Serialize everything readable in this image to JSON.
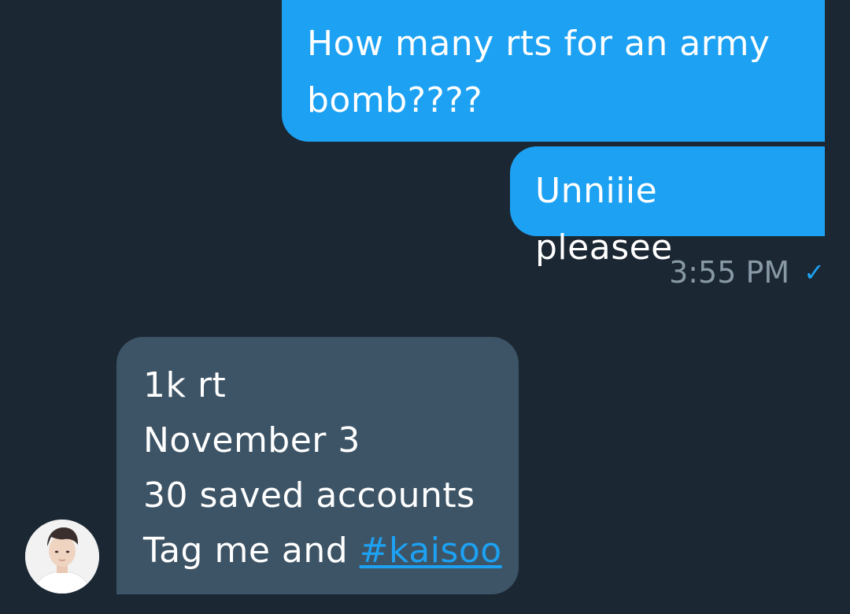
{
  "conversation": {
    "sent_messages": [
      {
        "text": "How many rts for an army bomb????"
      },
      {
        "text": "Unniiie pleasee"
      }
    ],
    "sent_meta": {
      "time": "3:55 PM",
      "status_icon": "checkmark-icon",
      "status_glyph": "✓"
    },
    "received_message": {
      "lines": [
        "1k rt",
        "November 3",
        "30 saved accounts"
      ],
      "last_line_prefix": "Tag me and ",
      "hashtag": "#kaisoo"
    },
    "avatar": {
      "icon": "user-avatar"
    }
  },
  "colors": {
    "background": "#1b2733",
    "sent_bubble": "#1da1f2",
    "received_bubble": "#3d5466",
    "timestamp": "#8899a6",
    "link": "#1da1f2"
  }
}
